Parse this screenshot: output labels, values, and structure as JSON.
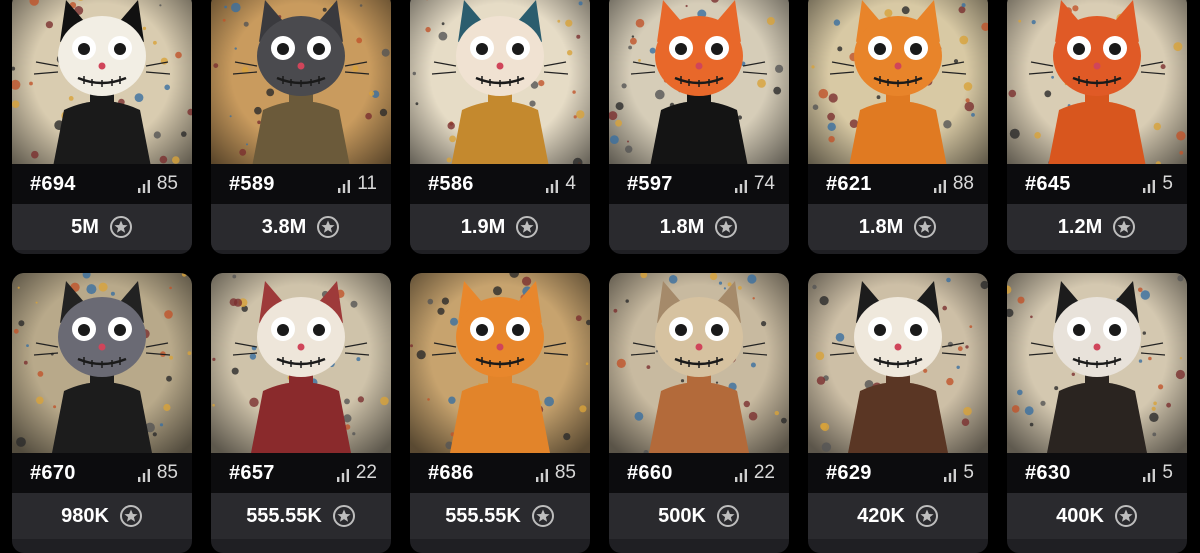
{
  "items": [
    {
      "id": "#694",
      "rank": "85",
      "price": "5M",
      "colors": {
        "bg": "#d9ccb0",
        "head": "#f2eee4",
        "body": "#1a1a1a",
        "ear": "#111111"
      }
    },
    {
      "id": "#589",
      "rank": "11",
      "price": "3.8M",
      "colors": {
        "bg": "#c99b5e",
        "head": "#4a4a4e",
        "body": "#6b5a3a",
        "ear": "#3a3a3e"
      }
    },
    {
      "id": "#586",
      "rank": "4",
      "price": "1.9M",
      "colors": {
        "bg": "#e6dcc6",
        "head": "#f0e2d2",
        "body": "#c4892e",
        "ear": "#2b5d6e"
      }
    },
    {
      "id": "#597",
      "rank": "74",
      "price": "1.8M",
      "colors": {
        "bg": "#d6cdb8",
        "head": "#e8682a",
        "body": "#141414",
        "ear": "#e8682a"
      }
    },
    {
      "id": "#621",
      "rank": "88",
      "price": "1.8M",
      "colors": {
        "bg": "#d8c9a4",
        "head": "#e8842a",
        "body": "#e07a22",
        "ear": "#e8842a"
      }
    },
    {
      "id": "#645",
      "rank": "5",
      "price": "1.2M",
      "colors": {
        "bg": "#d9cdb4",
        "head": "#e05a26",
        "body": "#d8561e",
        "ear": "#e05a26"
      }
    },
    {
      "id": "#670",
      "rank": "85",
      "price": "980K",
      "colors": {
        "bg": "#b8a98a",
        "head": "#6a6a74",
        "body": "#1c1c1c",
        "ear": "#222222"
      }
    },
    {
      "id": "#657",
      "rank": "22",
      "price": "555.55K",
      "colors": {
        "bg": "#cfc3aa",
        "head": "#eee6da",
        "body": "#8a2a2c",
        "ear": "#9e3a3a"
      }
    },
    {
      "id": "#686",
      "rank": "85",
      "price": "555.55K",
      "colors": {
        "bg": "#c7a36e",
        "head": "#e8872c",
        "body": "#e2842a",
        "ear": "#e8872c"
      }
    },
    {
      "id": "#660",
      "rank": "22",
      "price": "500K",
      "colors": {
        "bg": "#c8baa0",
        "head": "#d6c2a0",
        "body": "#b36a3a",
        "ear": "#a58a6a"
      }
    },
    {
      "id": "#629",
      "rank": "5",
      "price": "420K",
      "colors": {
        "bg": "#cdbfa6",
        "head": "#efe8dc",
        "body": "#5a3624",
        "ear": "#1c1c1c"
      }
    },
    {
      "id": "#630",
      "rank": "5",
      "price": "400K",
      "colors": {
        "bg": "#d4c8b0",
        "head": "#e8e2da",
        "body": "#2a2420",
        "ear": "#1c1c1c"
      }
    }
  ],
  "icons": {
    "rank": "bar-chart-icon",
    "currency": "star-coin-icon"
  }
}
